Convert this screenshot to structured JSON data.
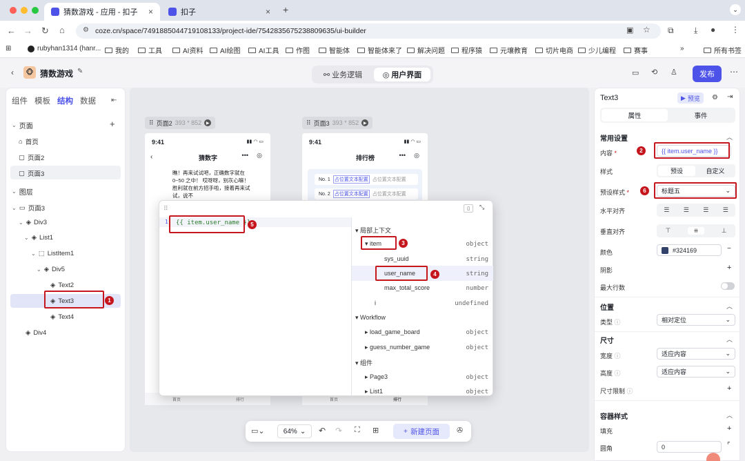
{
  "browser": {
    "tabs": [
      {
        "title": "猜数游戏 - 应用 - 扣子",
        "close": "×"
      },
      {
        "title": "扣子",
        "close": "×"
      }
    ],
    "new_tab": "+",
    "url": "coze.cn/space/7491885044719108133/project-ide/7542835675238809635/ui-builder",
    "bookmarks": [
      "rubyhan1314 (hanr...",
      "我的",
      "工具",
      "AI资料",
      "AI绘图",
      "AI工具",
      "作图",
      "智能体",
      "智能体来了",
      "解决问题",
      "程序猿",
      "元壤教育",
      "切片电商",
      "少儿编程",
      "赛事"
    ],
    "more_bookmarks": "»",
    "all_bookmarks": "所有书签"
  },
  "app": {
    "title": "猜数游戏",
    "seg": {
      "logic": "业务逻辑",
      "ui": "用户界面"
    },
    "publish": "发布"
  },
  "left": {
    "tabs": [
      "组件",
      "模板",
      "结构",
      "数据"
    ],
    "section_pages": "页面",
    "add": "+",
    "pages": [
      "首页",
      "页面2",
      "页面3"
    ],
    "section_layers": "图层",
    "layers": [
      "页面3",
      "Div3",
      "List1",
      "ListItem1",
      "Div5",
      "Text2",
      "Text3",
      "Text4",
      "Div4"
    ]
  },
  "canvas": {
    "page2_label": "页面2",
    "page2_size": "393 * 852",
    "page3_label": "页面3",
    "page3_size": "393 * 852",
    "time": "9:41",
    "page2_title": "猜数字",
    "page3_title": "排行榜",
    "game_text": "瞧！再来试试吧，正确数字就在0~50 之中！ 哎呀呀，别灰心嘛！胜利就在前方招手啦，接着再来试试，说不",
    "rank_rows": [
      {
        "no": "No. 1",
        "name": "占位置文本配置",
        "sub": "占位置文本配置"
      },
      {
        "no": "No. 2",
        "name": "占位置文本配置",
        "sub": "占位置文本配置"
      }
    ],
    "nav_items": [
      "首页",
      "排行",
      "首页",
      "排行"
    ],
    "zoom": "64%",
    "new_page": "新建页面"
  },
  "modal": {
    "line_no": "1",
    "expression": "{{ item.user_name }}",
    "ctx_header": "局部上下文",
    "item": "item",
    "item_type": "object",
    "fields": [
      {
        "name": "sys_uuid",
        "type": "string"
      },
      {
        "name": "user_name",
        "type": "string"
      },
      {
        "name": "max_total_score",
        "type": "number"
      }
    ],
    "i": "i",
    "i_type": "undefined",
    "wf_header": "Workflow",
    "workflows": [
      {
        "name": "load_game_board",
        "type": "object"
      },
      {
        "name": "guess_number_game",
        "type": "object"
      }
    ],
    "comp_header": "组件",
    "components": [
      {
        "name": "Page3",
        "type": "object"
      },
      {
        "name": "List1",
        "type": "object"
      }
    ]
  },
  "right": {
    "title": "Text3",
    "preview": "预览",
    "tab_props": "属性",
    "tab_events": "事件",
    "common": "常用设置",
    "content_label": "内容",
    "content_value": "{{ item.user_name }}",
    "style_label": "样式",
    "style_preset": "预设",
    "style_custom": "自定义",
    "preset_label": "预设样式",
    "preset_value": "标题五",
    "halign": "水平对齐",
    "valign": "垂直对齐",
    "color_label": "颜色",
    "color_value": "#324169",
    "shadow": "阴影",
    "max_lines": "最大行数",
    "position": "位置",
    "type_label": "类型",
    "type_value": "相对定位",
    "size": "尺寸",
    "width_label": "宽度",
    "width_value": "适应内容",
    "height_label": "高度",
    "height_value": "适应内容",
    "size_limit": "尺寸限制",
    "container": "容器样式",
    "fill": "填充",
    "radius": "圆角",
    "radius_value": "0"
  },
  "annotations": [
    "1",
    "2",
    "3",
    "4",
    "5",
    "6"
  ],
  "colors": {
    "brand": "#4d53e8",
    "red": "#c4161c",
    "text_color": "#324169"
  }
}
